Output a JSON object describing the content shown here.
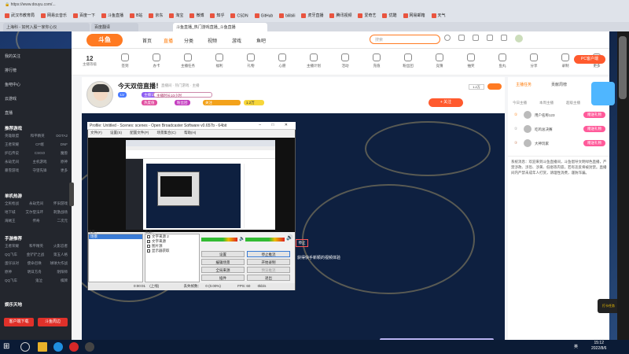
{
  "browser": {
    "url": "https://www.douyu.com/...",
    "bookmarks": [
      "武汉市教育局",
      "网易云音乐",
      "百度一下",
      "斗鱼直播",
      "B站",
      "京东",
      "淘宝",
      "微博",
      "知乎",
      "CSDN",
      "GitHub",
      "bilibili",
      "虎牙直播",
      "腾讯视频",
      "爱奇艺",
      "优酷",
      "网易邮箱",
      "天气"
    ],
    "tabs": [
      {
        "label": "上海科 - 如何入股一家你心仪"
      },
      {
        "label": "百度翻译"
      },
      {
        "label": "斗鱼直播_热门游戏直播_斗鱼直播"
      }
    ]
  },
  "nav": {
    "logo": "斗鱼",
    "items": [
      "首页",
      "直播",
      "分类",
      "视频",
      "游戏",
      "鱼吧",
      "赛程"
    ],
    "search_placeholder": "搜索"
  },
  "categories": {
    "first_num": "12",
    "first_label": "主播等级",
    "items": [
      "签到",
      "办卡",
      "主播任务",
      "福利",
      "礼物",
      "心愿",
      "主播计划",
      "活动",
      "充值",
      "粉丝团",
      "竞猜",
      "抽奖",
      "鱼丸",
      "分享",
      "录制",
      "更多",
      "PC客户端"
    ]
  },
  "sidebar": {
    "top_items": [
      "我的关注",
      "排行榜",
      "鱼吧中心",
      "云游戏",
      "直播"
    ],
    "section1": "推荐游戏",
    "grid1": [
      [
        "英雄联盟",
        "和平精英",
        "DOTA2"
      ],
      [
        "王者荣耀",
        "CF端",
        "DNF"
      ],
      [
        "炉石传说",
        "CSGO",
        "魔兽"
      ],
      [
        "永劫无间",
        "主机游戏",
        "原神"
      ],
      [
        "暴雪游戏",
        "守望先锋",
        "更多"
      ]
    ],
    "section2": "单机热游",
    "grid2": [
      [
        "全民枪战",
        "永劫无间",
        "怀旧游戏"
      ],
      [
        "地下城",
        "艾尔登法环",
        "刺激战场"
      ],
      [
        "海贼王",
        "传奇",
        "二次元"
      ]
    ],
    "section3": "手游推荐",
    "grid3": [
      [
        "王者荣耀",
        "和平精英",
        "火影忍者"
      ],
      [
        "QQ飞车",
        "金铲铲之战",
        "第五人格"
      ],
      [
        "蛋仔派对",
        "使命召唤",
        "球球大作战"
      ],
      [
        "原神",
        "明日方舟",
        "阴阳师"
      ],
      [
        "QQ飞车",
        "鬼泣",
        "棋牌"
      ]
    ],
    "section4": "娱乐天地",
    "btn1": "客户端下载",
    "btn2": "斗鱼周边"
  },
  "room": {
    "title": "今天双倍直播！",
    "sub": "直播间 · 热门游戏 · 主播",
    "tags": [
      "LV",
      "主播认证",
      "主播时长10小时",
      "热度值",
      "粉丝团",
      "关注"
    ],
    "follow": "+ 关注",
    "fans": "1.2万"
  },
  "obs": {
    "title": "Profile: Untitled - Scenes: scenes - Open Broadcaster Software v0.657b - 64bit",
    "menu": [
      "文件(F)",
      "设置(S)",
      "配置文件(P)",
      "场景集合(C)",
      "帮助(H)"
    ],
    "scenes_label": "场景：",
    "scene_selected": "场景",
    "sources_label": "来源：",
    "sources": [
      "文字来源 2",
      "文字来源",
      "图片源",
      "显示器获取"
    ],
    "buttons": [
      "设置",
      "停止推流",
      "编辑场景",
      "开始录制",
      "全局来源",
      "预览推流",
      "插件",
      "退出"
    ],
    "status": [
      "0:00:01",
      "(上线)",
      "丢失帧数：",
      "0 (0.00%)",
      "FPS: 60",
      "0kb/s"
    ],
    "stop_label": "停止",
    "overlay": "获得快手新颖的视频体验"
  },
  "right": {
    "tabs": [
      "主播任务",
      "贡献周榜"
    ],
    "subtabs": [
      "今日主播",
      "本周主播",
      "超级主播"
    ],
    "ranks": [
      {
        "name": "用户名称123",
        "btn": "赠送礼物"
      },
      {
        "name": "吃鸡总决赛",
        "btn": "赠送礼物"
      },
      {
        "name": "大神玩家",
        "btn": "赠送礼物"
      }
    ],
    "chat": "系统消息：欢迎来到斗鱼直播间，斗鱼倡导文明绿色直播，严禁涉政、涉恐、涉黄、低俗等内容，若有违反将被封禁。直播间内严禁未成年人打赏，请理性消费，谨防诈骗。"
  },
  "notice": "打卡任务",
  "taskbar": {
    "time": "15:12",
    "date": "2022/8/6",
    "lang": "英"
  },
  "colors": {
    "accent": "#ff7a22",
    "obs_meter": "#33bb33",
    "chrome": "#dfe3ea"
  }
}
